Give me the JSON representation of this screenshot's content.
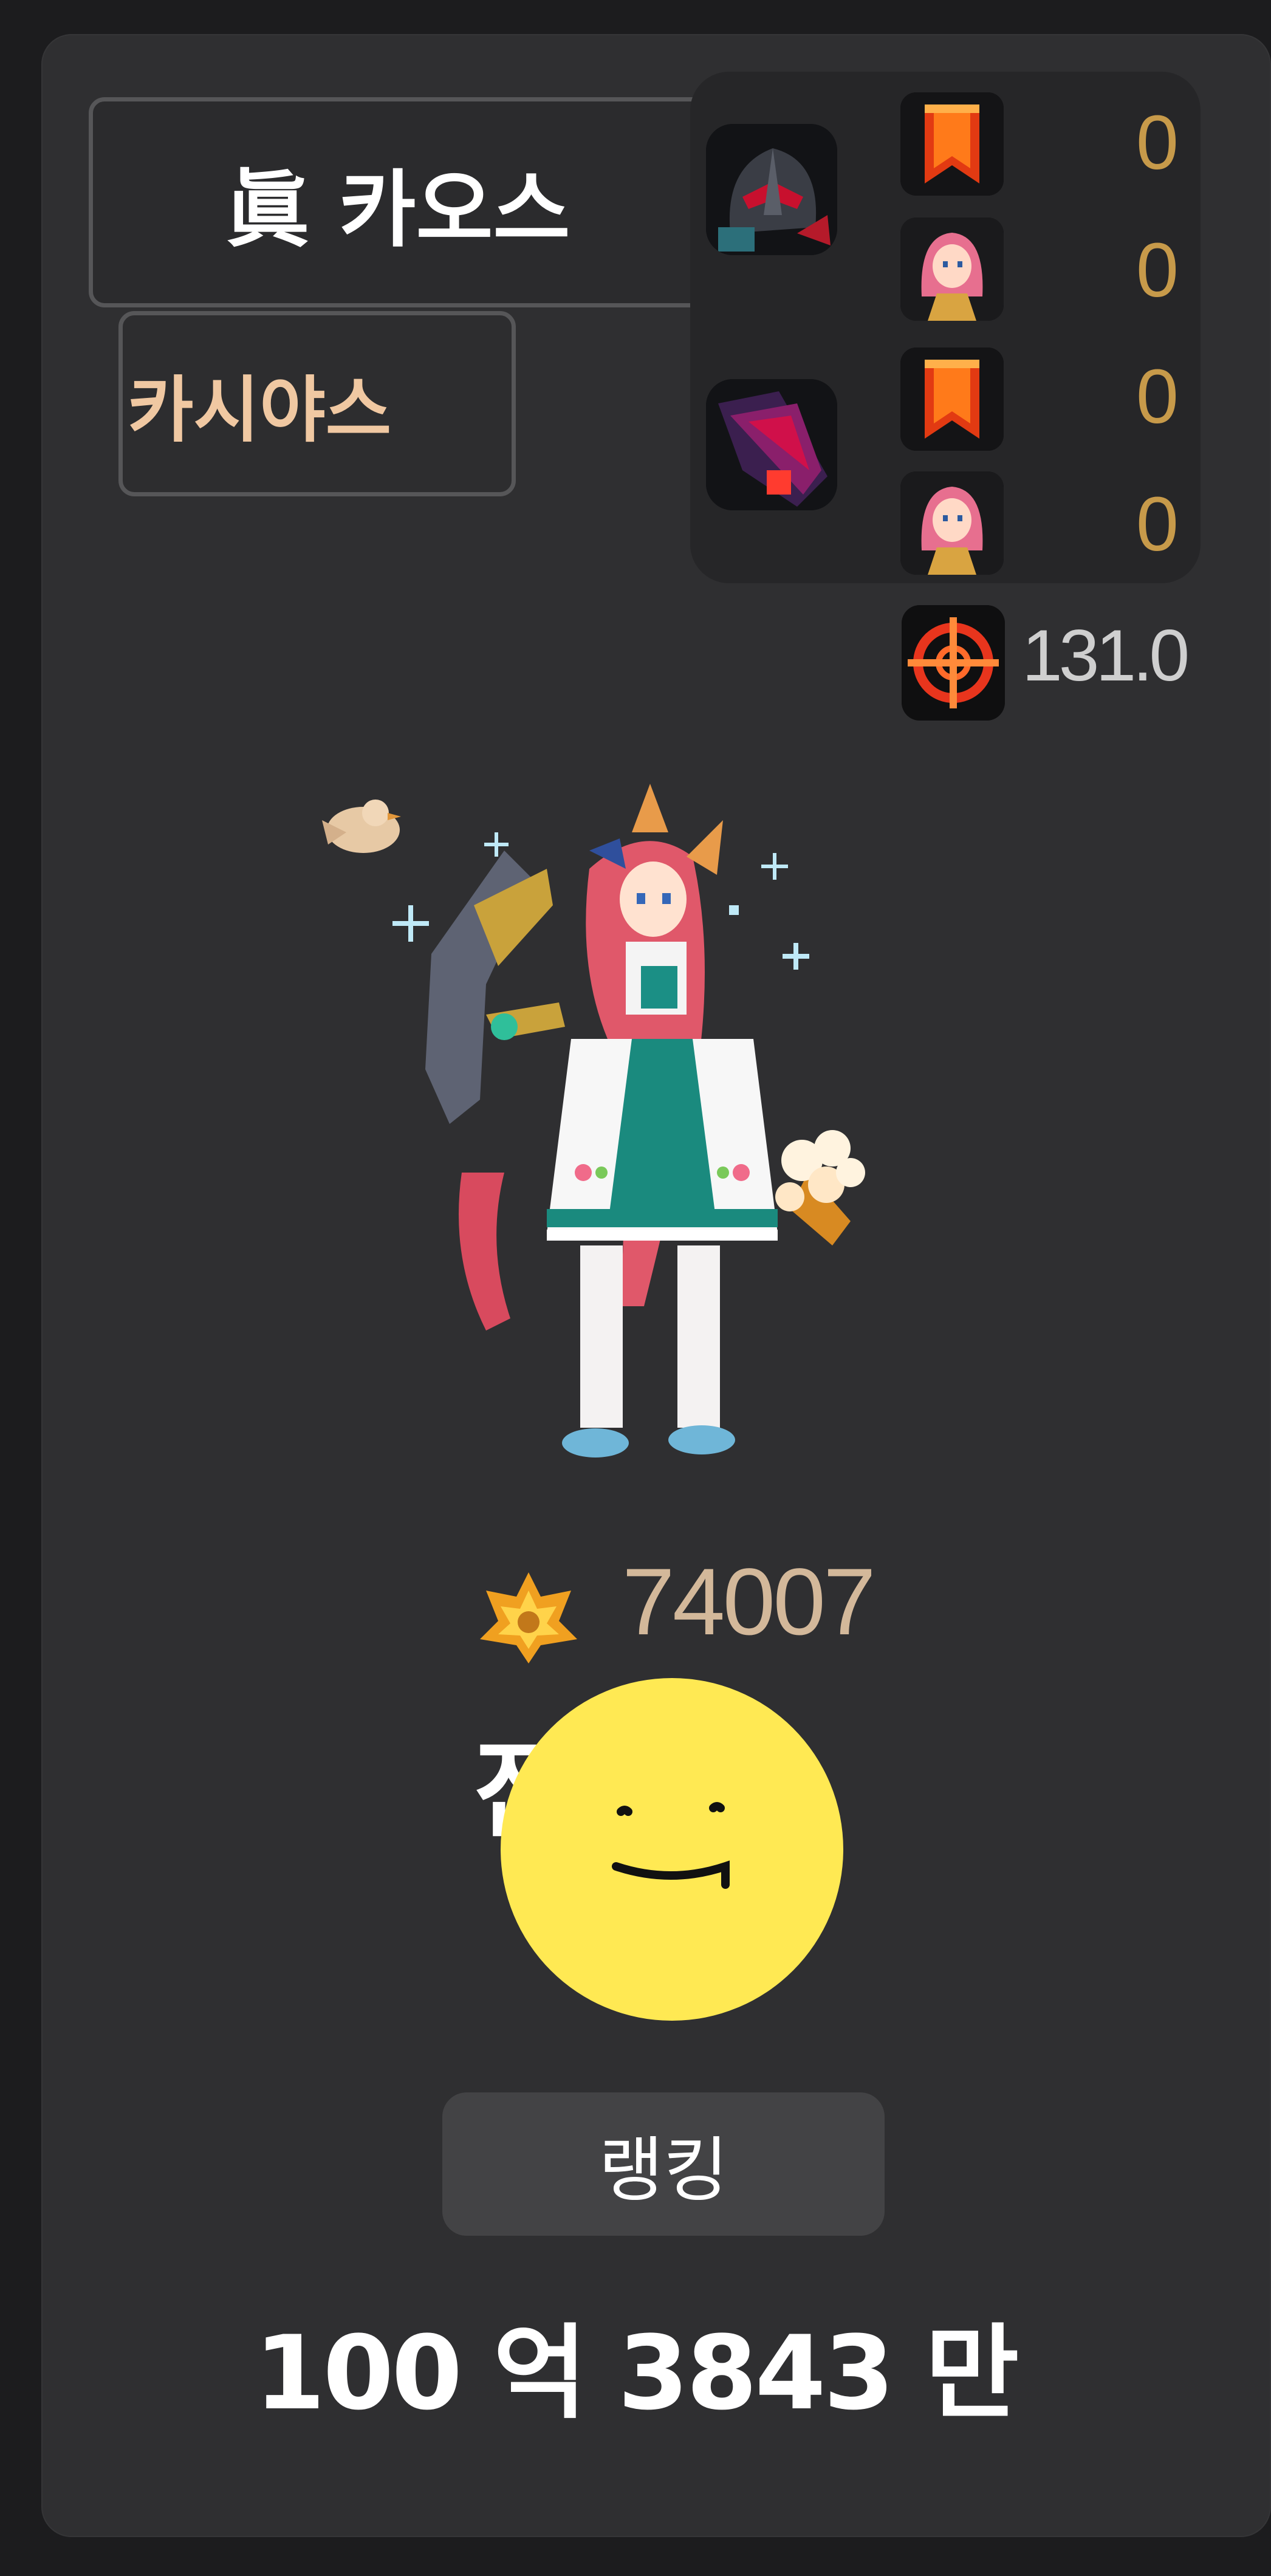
{
  "profile": {
    "job_title": "眞 카오스",
    "character_name": "카시야스",
    "guild_name": "잔",
    "power_value": "131.0",
    "fame_value": "74007"
  },
  "stats": [
    {
      "value": "0",
      "icon": "red-ribbon-icon"
    },
    {
      "value": "0",
      "icon": "pink-hair-portrait-icon"
    },
    {
      "value": "0",
      "icon": "red-ribbon-icon"
    },
    {
      "value": "0",
      "icon": "pink-hair-portrait-icon"
    }
  ],
  "actions": {
    "ranking_label": "랭킹"
  },
  "footer": {
    "total_label": "100 억 3843 만"
  },
  "colors": {
    "background": "#1c1c1e",
    "card": "#2f2f31",
    "accent_gold": "#c79a4a",
    "name_peach": "#f0c8a2",
    "fame_tan": "#d3b89a",
    "smiley_yellow": "#ffe953"
  }
}
